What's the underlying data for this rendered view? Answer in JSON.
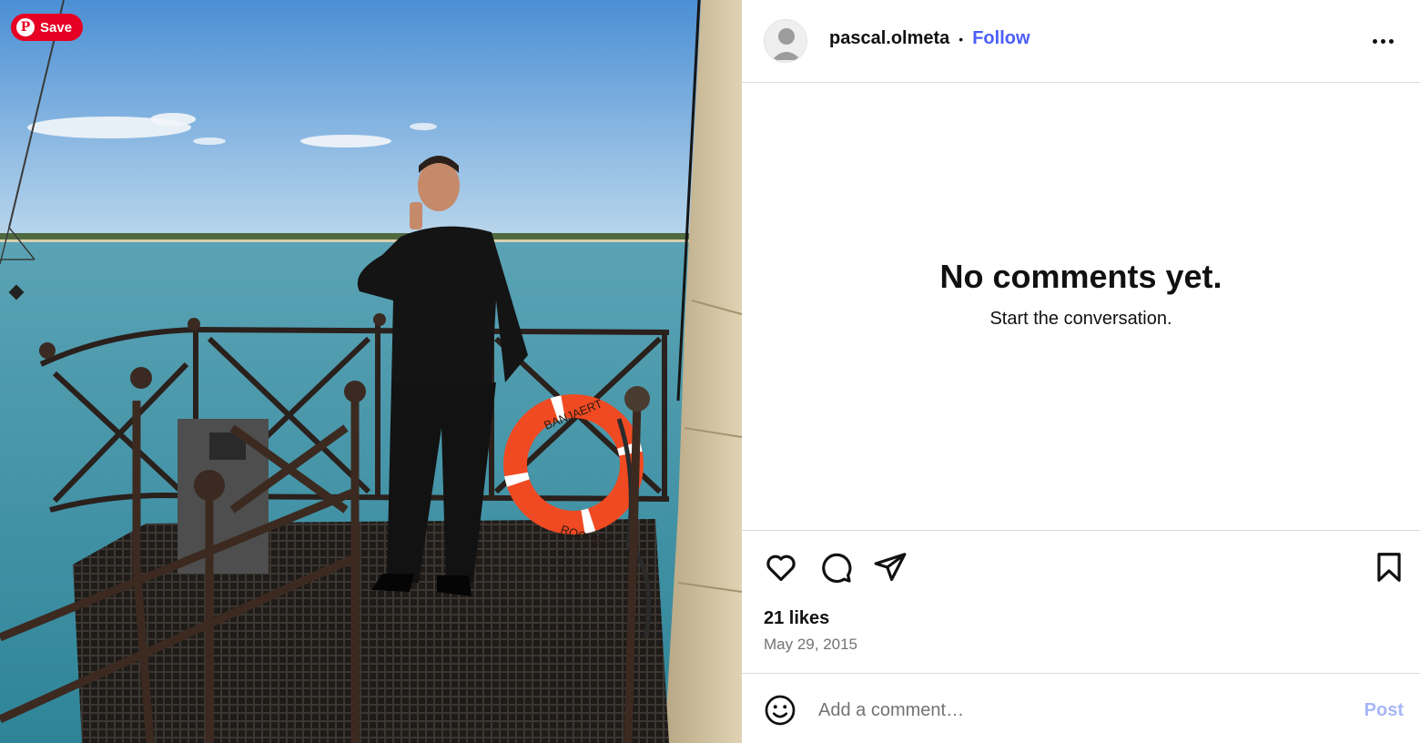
{
  "photo": {
    "save_label": "Save",
    "pin_icon": "pinterest-icon",
    "lifebuoy_text_top": "BANJAERT",
    "lifebuoy_text_bottom": "ROCHEF",
    "colors": {
      "sky": "#8fc1e3",
      "sea": "#3f95a8",
      "lifebuoy": "#f04a22",
      "pinterest": "#e60023"
    }
  },
  "header": {
    "username": "pascal.olmeta",
    "separator": "•",
    "follow_label": "Follow",
    "more_icon": "more-options-icon"
  },
  "comments": {
    "empty_title": "No comments yet.",
    "empty_subtitle": "Start the conversation."
  },
  "actions": {
    "icons": [
      "heart-icon",
      "comment-icon",
      "share-icon",
      "bookmark-icon"
    ]
  },
  "post_meta": {
    "likes": "21 likes",
    "date": "May 29, 2015"
  },
  "comment_bar": {
    "placeholder": "Add a comment…",
    "post_label": "Post",
    "emoji_icon": "emoji-icon"
  },
  "colors": {
    "follow": "#4a5df9",
    "post_disabled": "#a7b6f7",
    "muted": "#737373",
    "divider": "#dbdbdb"
  }
}
